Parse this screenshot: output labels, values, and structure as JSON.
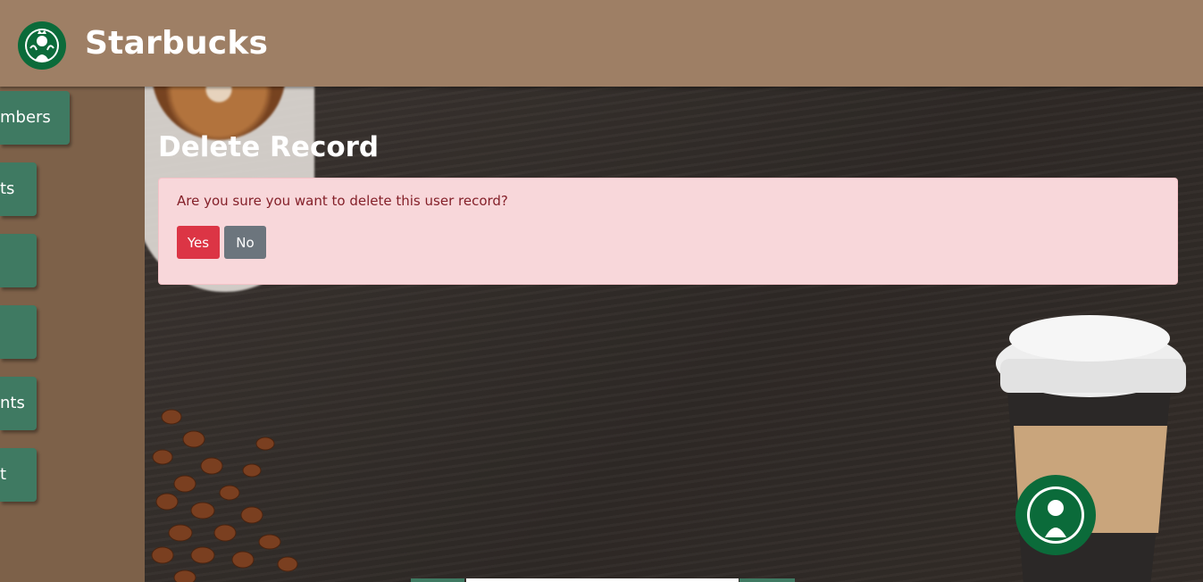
{
  "header": {
    "brand": "Starbucks",
    "logo_icon": "starbucks-siren-logo-icon",
    "background": "#9e7f65"
  },
  "sidebar": {
    "background": "#7d6149",
    "button_color": "#3f7a62",
    "items": [
      {
        "label": "mbers"
      },
      {
        "label": "ts"
      },
      {
        "label": ""
      },
      {
        "label": ""
      },
      {
        "label": "nts"
      },
      {
        "label": "t"
      }
    ]
  },
  "main": {
    "title": "Delete Record",
    "alert": {
      "message": "Are you sure you want to delete this user record?",
      "yes_label": "Yes",
      "no_label": "No",
      "background": "#f8d7da",
      "text_color": "#842029"
    },
    "colors": {
      "yes_button": "#dc3545",
      "no_button": "#6c757d"
    }
  }
}
